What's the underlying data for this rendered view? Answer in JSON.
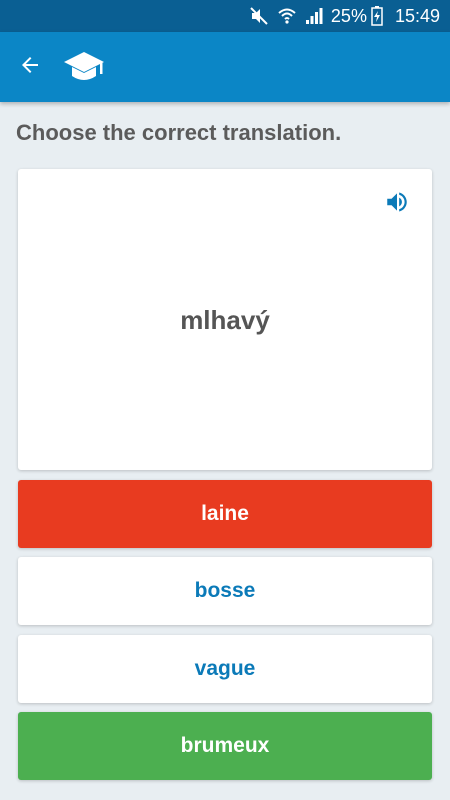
{
  "status_bar": {
    "battery": "25%",
    "time": "15:49"
  },
  "app_bar": {
    "back_icon": "arrow-left-icon",
    "logo_icon": "graduation-cap-icon"
  },
  "quiz": {
    "prompt": "Choose the correct translation.",
    "word": "mlhavý",
    "speaker_icon": "speaker-icon",
    "answers": [
      {
        "label": "laine",
        "state": "wrong"
      },
      {
        "label": "bosse",
        "state": "neutral"
      },
      {
        "label": "vague",
        "state": "neutral"
      },
      {
        "label": "brumeux",
        "state": "correct"
      }
    ]
  },
  "colors": {
    "status_bar": "#0a5f93",
    "app_bar": "#0b86c6",
    "background": "#e8eef2",
    "wrong": "#e83b20",
    "correct": "#4caf50",
    "answer_text": "#0b7ab8"
  }
}
